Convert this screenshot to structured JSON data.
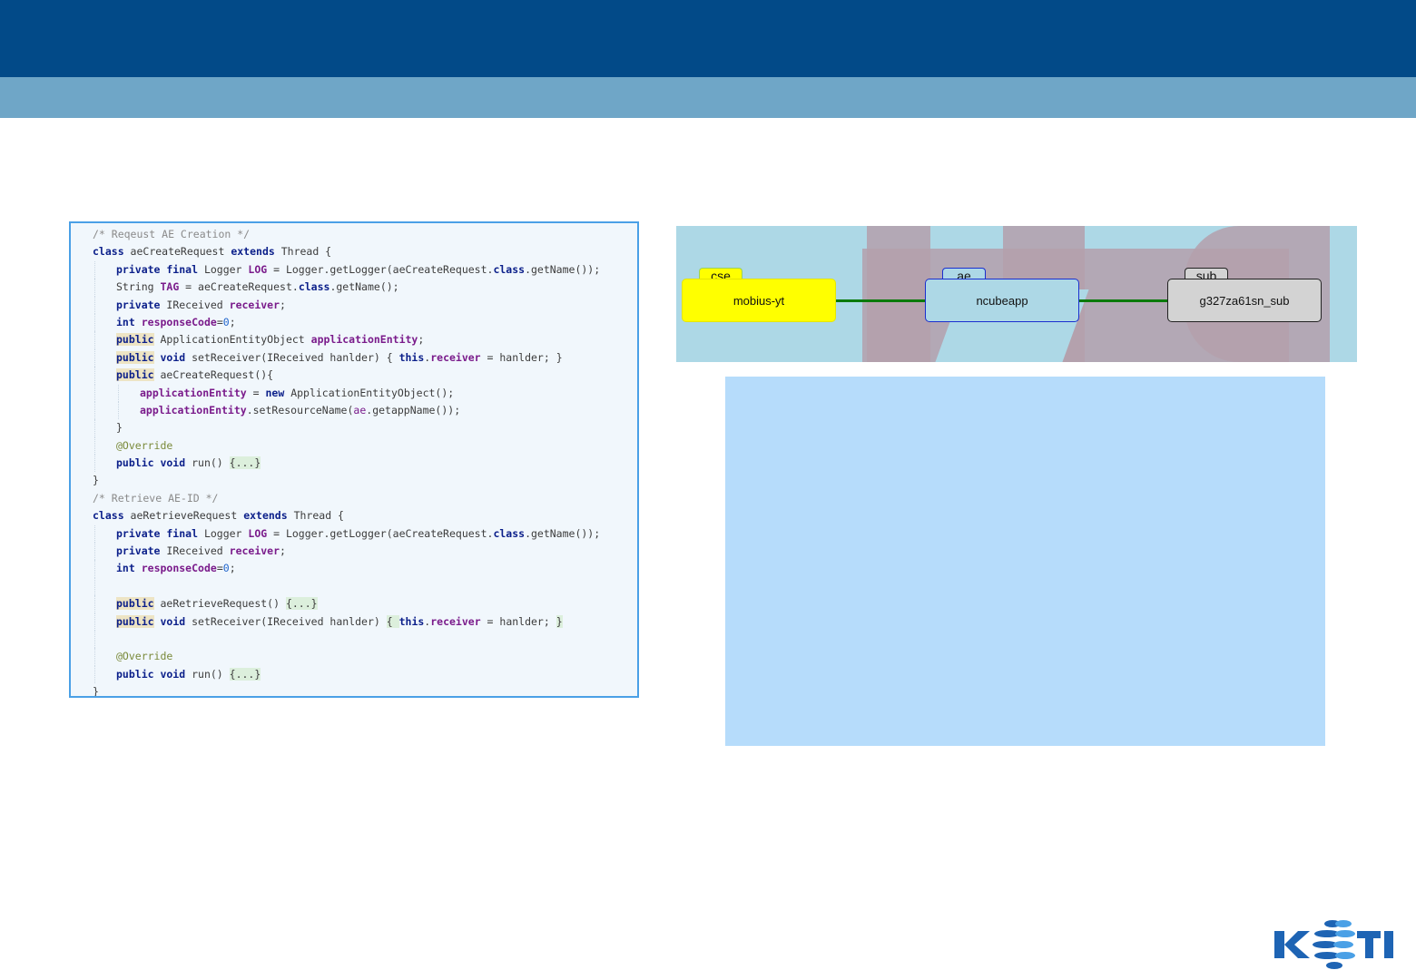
{
  "colors": {
    "header_bar": "#024a88",
    "sub_bar": "#6fa6c7",
    "code_border": "#4aa0e6",
    "diagram_bg": "#add8e6",
    "cse_node": "#ffff00",
    "ae_node": "#add8e6",
    "sub_node": "#d3d3d3",
    "connector": "#0b7a0b",
    "blank_panel": "#b6dcfb",
    "logo_primary": "#1e64b4"
  },
  "code": {
    "lines": [
      {
        "indent": 1,
        "segments": [
          {
            "c": "cmt",
            "t": "/* Reqeust AE Creation */"
          }
        ]
      },
      {
        "indent": 1,
        "segments": [
          {
            "c": "kw",
            "t": "class"
          },
          {
            "c": "plain",
            "t": " aeCreateRequest "
          },
          {
            "c": "kw",
            "t": "extends"
          },
          {
            "c": "plain",
            "t": " Thread {"
          }
        ]
      },
      {
        "indent": 2,
        "segments": [
          {
            "c": "kw",
            "t": "private final"
          },
          {
            "c": "plain",
            "t": " Logger "
          },
          {
            "c": "fld",
            "t": "LOG"
          },
          {
            "c": "plain",
            "t": " = Logger.getLogger(aeCreateRequest."
          },
          {
            "c": "kw",
            "t": "class"
          },
          {
            "c": "plain",
            "t": ".getName());"
          }
        ]
      },
      {
        "indent": 2,
        "segments": [
          {
            "c": "plain",
            "t": "String "
          },
          {
            "c": "fld",
            "t": "TAG"
          },
          {
            "c": "plain",
            "t": " = aeCreateRequest."
          },
          {
            "c": "kw",
            "t": "class"
          },
          {
            "c": "plain",
            "t": ".getName();"
          }
        ]
      },
      {
        "indent": 2,
        "segments": [
          {
            "c": "kw",
            "t": "private"
          },
          {
            "c": "plain",
            "t": " IReceived "
          },
          {
            "c": "fld",
            "t": "receiver"
          },
          {
            "c": "plain",
            "t": ";"
          }
        ]
      },
      {
        "indent": 2,
        "segments": [
          {
            "c": "kw",
            "t": "int"
          },
          {
            "c": "plain",
            "t": " "
          },
          {
            "c": "fld",
            "t": "responseCode"
          },
          {
            "c": "plain",
            "t": "="
          },
          {
            "c": "num",
            "t": "0"
          },
          {
            "c": "plain",
            "t": ";"
          }
        ]
      },
      {
        "indent": 2,
        "segments": [
          {
            "c": "kw",
            "t": "public",
            "hl": "pub"
          },
          {
            "c": "plain",
            "t": " ApplicationEntityObject "
          },
          {
            "c": "fld",
            "t": "applicationEntity"
          },
          {
            "c": "plain",
            "t": ";"
          }
        ]
      },
      {
        "indent": 2,
        "segments": [
          {
            "c": "kw",
            "t": "public",
            "hl": "pub"
          },
          {
            "c": "kw",
            "t": " void"
          },
          {
            "c": "plain",
            "t": " setReceiver(IReceived hanlder) { "
          },
          {
            "c": "kw",
            "t": "this"
          },
          {
            "c": "plain",
            "t": "."
          },
          {
            "c": "fld",
            "t": "receiver"
          },
          {
            "c": "plain",
            "t": " = hanlder; }"
          }
        ]
      },
      {
        "indent": 2,
        "segments": [
          {
            "c": "kw",
            "t": "public",
            "hl": "pub"
          },
          {
            "c": "plain",
            "t": " aeCreateRequest(){"
          }
        ]
      },
      {
        "indent": 3,
        "segments": [
          {
            "c": "fld",
            "t": "applicationEntity"
          },
          {
            "c": "plain",
            "t": " = "
          },
          {
            "c": "kw",
            "t": "new"
          },
          {
            "c": "plain",
            "t": " ApplicationEntityObject();"
          }
        ]
      },
      {
        "indent": 3,
        "segments": [
          {
            "c": "fld",
            "t": "applicationEntity"
          },
          {
            "c": "plain",
            "t": ".setResourceName("
          },
          {
            "c": "var",
            "t": "ae"
          },
          {
            "c": "plain",
            "t": ".getappName());"
          }
        ]
      },
      {
        "indent": 2,
        "segments": [
          {
            "c": "plain",
            "t": "}"
          }
        ]
      },
      {
        "indent": 2,
        "segments": [
          {
            "c": "ann",
            "t": "@Override"
          }
        ]
      },
      {
        "indent": 2,
        "segments": [
          {
            "c": "kw",
            "t": "public void"
          },
          {
            "c": "plain",
            "t": " run() "
          },
          {
            "c": "plain",
            "t": "{...}",
            "hl": "fold"
          }
        ]
      },
      {
        "indent": 1,
        "segments": [
          {
            "c": "plain",
            "t": "}"
          }
        ]
      },
      {
        "indent": 1,
        "segments": [
          {
            "c": "cmt",
            "t": "/* Retrieve AE-ID */"
          }
        ]
      },
      {
        "indent": 1,
        "segments": [
          {
            "c": "kw",
            "t": "class"
          },
          {
            "c": "plain",
            "t": " aeRetrieveRequest "
          },
          {
            "c": "kw",
            "t": "extends"
          },
          {
            "c": "plain",
            "t": " Thread {"
          }
        ]
      },
      {
        "indent": 2,
        "segments": [
          {
            "c": "kw",
            "t": "private final"
          },
          {
            "c": "plain",
            "t": " Logger "
          },
          {
            "c": "fld",
            "t": "LOG"
          },
          {
            "c": "plain",
            "t": " = Logger.getLogger(aeCreateRequest."
          },
          {
            "c": "kw",
            "t": "class"
          },
          {
            "c": "plain",
            "t": ".getName());"
          }
        ]
      },
      {
        "indent": 2,
        "segments": [
          {
            "c": "kw",
            "t": "private"
          },
          {
            "c": "plain",
            "t": " IReceived "
          },
          {
            "c": "fld",
            "t": "receiver"
          },
          {
            "c": "plain",
            "t": ";"
          }
        ]
      },
      {
        "indent": 2,
        "segments": [
          {
            "c": "kw",
            "t": "int"
          },
          {
            "c": "plain",
            "t": " "
          },
          {
            "c": "fld",
            "t": "responseCode"
          },
          {
            "c": "plain",
            "t": "="
          },
          {
            "c": "num",
            "t": "0"
          },
          {
            "c": "plain",
            "t": ";"
          }
        ]
      },
      {
        "indent": 2,
        "segments": []
      },
      {
        "indent": 2,
        "segments": [
          {
            "c": "kw",
            "t": "public",
            "hl": "pub"
          },
          {
            "c": "plain",
            "t": " aeRetrieveRequest() "
          },
          {
            "c": "plain",
            "t": "{...}",
            "hl": "fold"
          }
        ]
      },
      {
        "indent": 2,
        "segments": [
          {
            "c": "kw",
            "t": "public",
            "hl": "pub"
          },
          {
            "c": "kw",
            "t": " void"
          },
          {
            "c": "plain",
            "t": " setReceiver(IReceived hanlder) "
          },
          {
            "c": "plain",
            "t": "{ ",
            "hl": "fold"
          },
          {
            "c": "kw",
            "t": "this"
          },
          {
            "c": "plain",
            "t": "."
          },
          {
            "c": "fld",
            "t": "receiver"
          },
          {
            "c": "plain",
            "t": " = hanlder; "
          },
          {
            "c": "plain",
            "t": "}",
            "hl": "fold"
          }
        ]
      },
      {
        "indent": 2,
        "segments": []
      },
      {
        "indent": 2,
        "segments": [
          {
            "c": "ann",
            "t": "@Override"
          }
        ]
      },
      {
        "indent": 2,
        "segments": [
          {
            "c": "kw",
            "t": "public void"
          },
          {
            "c": "plain",
            "t": " run() "
          },
          {
            "c": "plain",
            "t": "{...}",
            "hl": "fold"
          }
        ]
      },
      {
        "indent": 1,
        "segments": [
          {
            "c": "plain",
            "t": "}"
          }
        ]
      }
    ]
  },
  "diagram": {
    "nodes": {
      "cse": {
        "tag": "cse",
        "label": "mobius-yt"
      },
      "ae": {
        "tag": "ae",
        "label": "ncubeapp"
      },
      "sub": {
        "tag": "sub",
        "label": "g327za61sn_sub"
      }
    }
  },
  "logo": {
    "text": "KETI"
  }
}
